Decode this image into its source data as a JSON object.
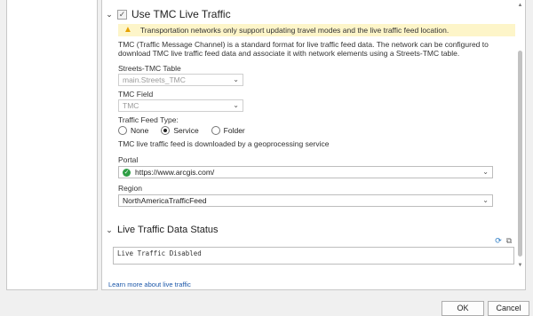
{
  "tmc_section": {
    "title": "Use TMC Live Traffic",
    "checked": "✓",
    "warning": "Transportation networks only support updating travel modes and the live traffic feed location.",
    "description": "TMC (Traffic Message Channel) is a standard format for live traffic feed data. The network can be configured to download TMC live traffic feed data and associate it with network elements using a Streets-TMC table."
  },
  "streets_tmc": {
    "label": "Streets-TMC Table",
    "value": "main.Streets_TMC"
  },
  "tmc_field": {
    "label": "TMC Field",
    "value": "TMC"
  },
  "feed_type": {
    "label": "Traffic Feed Type:",
    "options": [
      "None",
      "Service",
      "Folder"
    ],
    "selected": "Service",
    "note": "TMC live traffic feed is downloaded by a geoprocessing service"
  },
  "portal": {
    "label": "Portal",
    "value": "https://www.arcgis.com/"
  },
  "region": {
    "label": "Region",
    "value": "NorthAmericaTrafficFeed"
  },
  "status_section": {
    "title": "Live Traffic Data Status",
    "status_text": "Live Traffic Disabled"
  },
  "learn_more_link": "Learn more about live traffic",
  "buttons": {
    "ok": "OK",
    "cancel": "Cancel"
  },
  "colors": {
    "warning_background": "#fdf5c9",
    "warning_icon": "#e6a100",
    "link": "#1a56a8",
    "status_ok": "#2e9e44",
    "refresh_icon": "#2b7bc4"
  },
  "icons": {
    "warning": "warning-triangle-icon",
    "portal_status": "check-circle-icon",
    "refresh": "refresh-icon",
    "copy": "copy-icon"
  }
}
